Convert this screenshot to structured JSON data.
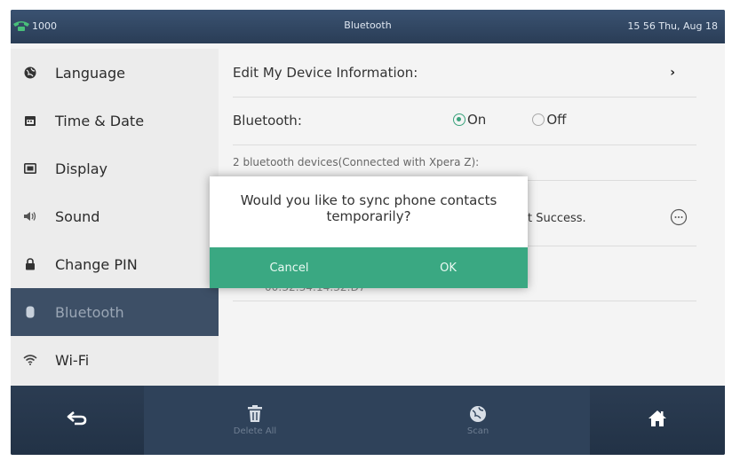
{
  "status_bar": {
    "extension": "1000",
    "title": "Bluetooth",
    "datetime": "15 56 Thu, Aug 18"
  },
  "sidebar": {
    "items": [
      {
        "label": "Language",
        "icon": "globe-icon"
      },
      {
        "label": "Time & Date",
        "icon": "calendar-icon"
      },
      {
        "label": "Display",
        "icon": "display-icon"
      },
      {
        "label": "Sound",
        "icon": "speaker-icon"
      },
      {
        "label": "Change PIN",
        "icon": "lock-icon"
      },
      {
        "label": "Bluetooth",
        "icon": "bluetooth-icon",
        "active": true
      },
      {
        "label": "Wi-Fi",
        "icon": "wifi-icon"
      }
    ]
  },
  "main": {
    "edit_device_label": "Edit My Device Information:",
    "chevron": "›",
    "bluetooth_label": "Bluetooth:",
    "bluetooth_on": "On",
    "bluetooth_off": "Off",
    "bluetooth_state": "On",
    "devices_summary": "2 bluetooth devices(Connected with  Xpera Z):",
    "device1_status": "t Success.",
    "device2_mac": "00:32:34:14:32:D7"
  },
  "dialog": {
    "message_line1": "Would you like to sync phone contacts",
    "message_line2": "temporarily?",
    "cancel_label": "Cancel",
    "ok_label": "OK"
  },
  "bottom_bar": {
    "delete_all_label": "Delete All",
    "scan_label": "Scan"
  },
  "colors": {
    "accent_green": "#3aa882",
    "active_item_bg": "#3d4f66",
    "status_bar_bg": "#33496a"
  }
}
